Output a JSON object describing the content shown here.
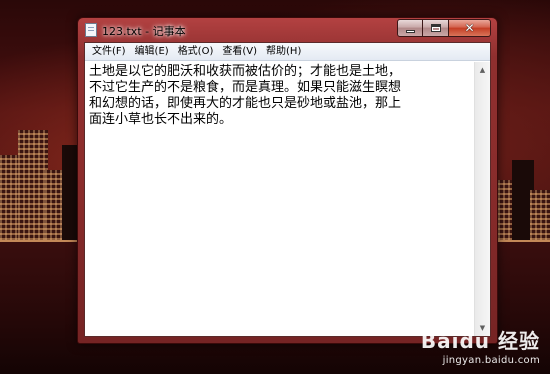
{
  "window": {
    "title": "123.txt - 记事本",
    "icon": "notepad-icon"
  },
  "menu": {
    "items": [
      "文件(F)",
      "编辑(E)",
      "格式(O)",
      "查看(V)",
      "帮助(H)"
    ]
  },
  "editor": {
    "content": "土地是以它的肥沃和收获而被估价的；才能也是土地，\n不过它生产的不是粮食，而是真理。如果只能滋生瞑想\n和幻想的话，即使再大的才能也只是砂地或盐池，那上\n面连小草也长不出来的。"
  },
  "watermark": {
    "logo": "Baidu 经验",
    "url": "jingyan.baidu.com"
  },
  "colors": {
    "window_frame": "#96323a",
    "close_button": "#c43d24",
    "menubar": "#e4eaf3"
  }
}
